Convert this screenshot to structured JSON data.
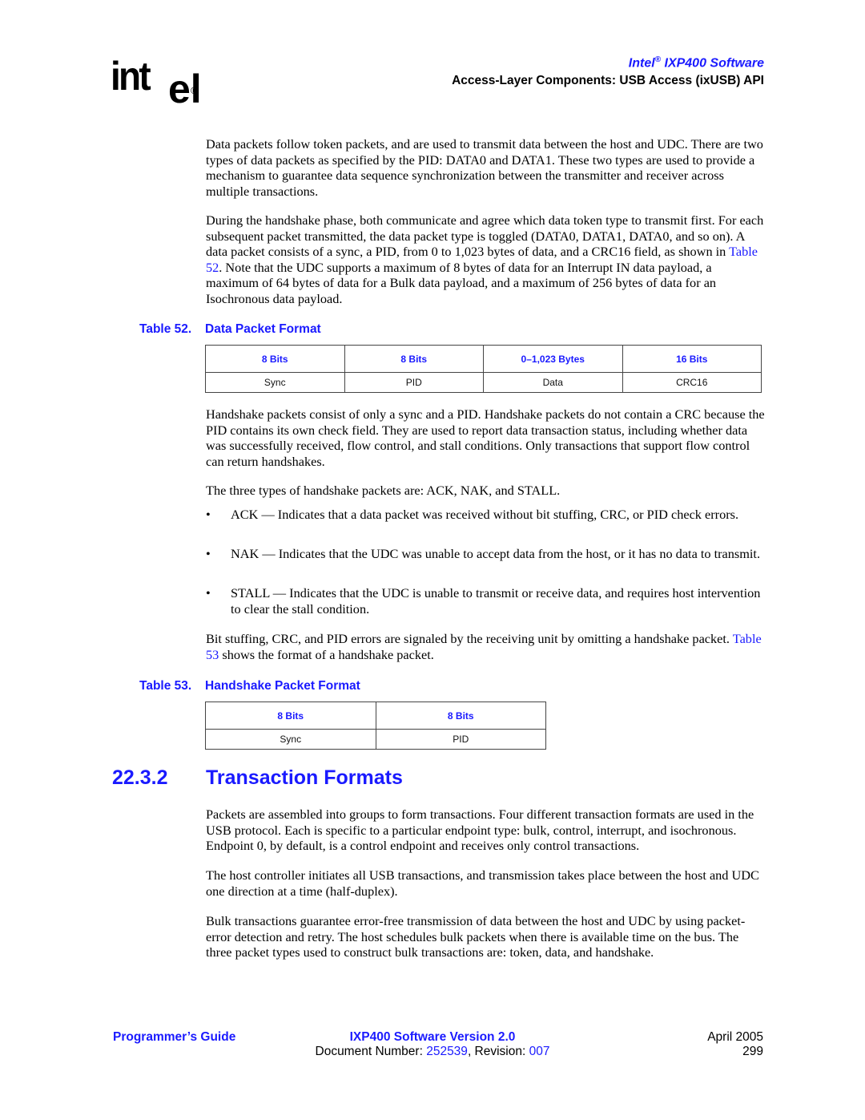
{
  "header": {
    "logo_text": "int",
    "logo_e": "el",
    "logo_reg": "®",
    "product_prefix": "Intel",
    "product_reg": "®",
    "product_suffix": " IXP400 Software",
    "section": "Access-Layer Components: USB Access (ixUSB) API"
  },
  "paragraphs": {
    "p1": "Data packets follow token packets, and are used to transmit data between the host and UDC. There are two types of data packets as specified by the PID: DATA0 and DATA1. These two types are used to provide a mechanism to guarantee data sequence synchronization between the transmitter and receiver across multiple transactions.",
    "p2_a": "During the handshake phase, both communicate and agree which data token type to transmit first. For each subsequent packet transmitted, the data packet type is toggled (DATA0, DATA1, DATA0, and so on). A data packet consists of a sync, a PID, from 0 to 1,023 bytes of data, and a CRC16 field, as shown in ",
    "p2_link": "Table 52",
    "p2_b": ". Note that the UDC supports a maximum of 8 bytes of data for an Interrupt IN data payload, a maximum of 64 bytes of data for a Bulk data payload, and a maximum of 256 bytes of data for an Isochronous data payload.",
    "p3": "Handshake packets consist of only a sync and a PID. Handshake packets do not contain a CRC because the PID contains its own check field. They are used to report data transaction status, including whether data was successfully received, flow control, and stall conditions. Only transactions that support flow control can return handshakes.",
    "p4": "The three types of handshake packets are: ACK, NAK, and STALL.",
    "p5_a": "Bit stuffing, CRC, and PID errors are signaled by the receiving unit by omitting a handshake packet. ",
    "p5_link": "Table 53",
    "p5_b": " shows the format of a handshake packet.",
    "p6": "Packets are assembled into groups to form transactions. Four different transaction formats are used in the USB protocol. Each is specific to a particular endpoint type: bulk, control, interrupt, and isochronous. Endpoint 0, by default, is a control endpoint and receives only control transactions.",
    "p7": "The host controller initiates all USB transactions, and transmission takes place between the host and UDC one direction at a time (half-duplex).",
    "p8": "Bulk transactions guarantee error-free transmission of data between the host and UDC by using packet-error detection and retry. The host schedules bulk packets when there is available time on the bus. The three packet types used to construct bulk transactions are: token, data, and handshake."
  },
  "bullets": [
    {
      "glyph": "•",
      "text": "ACK — Indicates that a data packet was received without bit stuffing, CRC, or PID check errors."
    },
    {
      "glyph": "•",
      "text": "NAK — Indicates that the UDC was unable to accept data from the host, or it has no data to transmit."
    },
    {
      "glyph": "•",
      "text": "STALL — Indicates that the UDC is unable to transmit or receive data, and requires host intervention to clear the stall condition."
    }
  ],
  "table52": {
    "number": "Table 52.",
    "title": "Data Packet Format",
    "headers": [
      "8 Bits",
      "8 Bits",
      "0–1,023 Bytes",
      "16 Bits"
    ],
    "cells": [
      "Sync",
      "PID",
      "Data",
      "CRC16"
    ]
  },
  "table53": {
    "number": "Table 53.",
    "title": "Handshake Packet Format",
    "headers": [
      "8 Bits",
      "8 Bits"
    ],
    "cells": [
      "Sync",
      "PID"
    ]
  },
  "section": {
    "number": "22.3.2",
    "title": "Transaction Formats"
  },
  "footer": {
    "left": "Programmer’s Guide",
    "center_title": "IXP400 Software Version 2.0",
    "docnum_label": "Document Number: ",
    "docnum": "252539",
    "revision_label": ", Revision: ",
    "revision": "007",
    "date": "April 2005",
    "page": "299"
  },
  "colors": {
    "accent_blue": "#1a1aff",
    "text": "#000000",
    "table_border": "#444444"
  }
}
